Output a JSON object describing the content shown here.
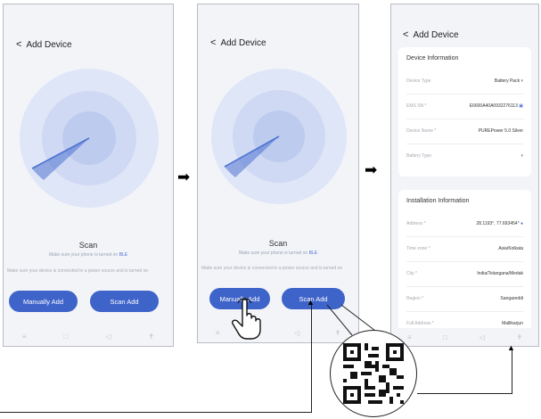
{
  "screen1": {
    "back_label": "Add Device",
    "scan_title": "Scan",
    "scan_hint_prefix": "Make sure your phone is turned on ",
    "scan_hint_highlight": "BLE",
    "note": "Make sure your device is connected to a power source and is turned on",
    "manual_add_label": "Manually Add",
    "scan_add_label": "Scan Add"
  },
  "screen2": {
    "back_label": "Add Device",
    "scan_title": "Scan",
    "scan_hint_prefix": "Make sure your phone is turned on ",
    "scan_hint_highlight": "BLE",
    "note": "Make sure your device is connected to a power source and is turned on",
    "manual_add_label": "Manually Add",
    "scan_add_label": "Scan Add"
  },
  "screen3": {
    "back_label": "Add Device",
    "device_info": {
      "title": "Device Information",
      "rows": [
        {
          "label": "Device Type",
          "value": "Battery Pack"
        },
        {
          "label": "EMS SN *",
          "value": "E6600A40A0932276113"
        },
        {
          "label": "Device Name *",
          "value": "PUREPower 5.0 Silver"
        },
        {
          "label": "Battery Type",
          "value": ""
        }
      ]
    },
    "install_info": {
      "title": "Installation Information",
      "rows": [
        {
          "label": "Address *",
          "value": "28.1193°, 77.693454°"
        },
        {
          "label": "Time zone *",
          "value": "Asia/Kolkata"
        },
        {
          "label": "City *",
          "value": "India/Telangana/Medak"
        },
        {
          "label": "Region *",
          "value": "Sangareddi"
        },
        {
          "label": "Full Address *",
          "value": "Mallikarjun"
        }
      ]
    }
  },
  "colors": {
    "accent": "#3e63c9",
    "radar_outer": "#dfe6f7",
    "radar_middle": "#cfd9f3",
    "radar_inner": "#bccbee",
    "radar_sweep": "#4e73d2"
  }
}
